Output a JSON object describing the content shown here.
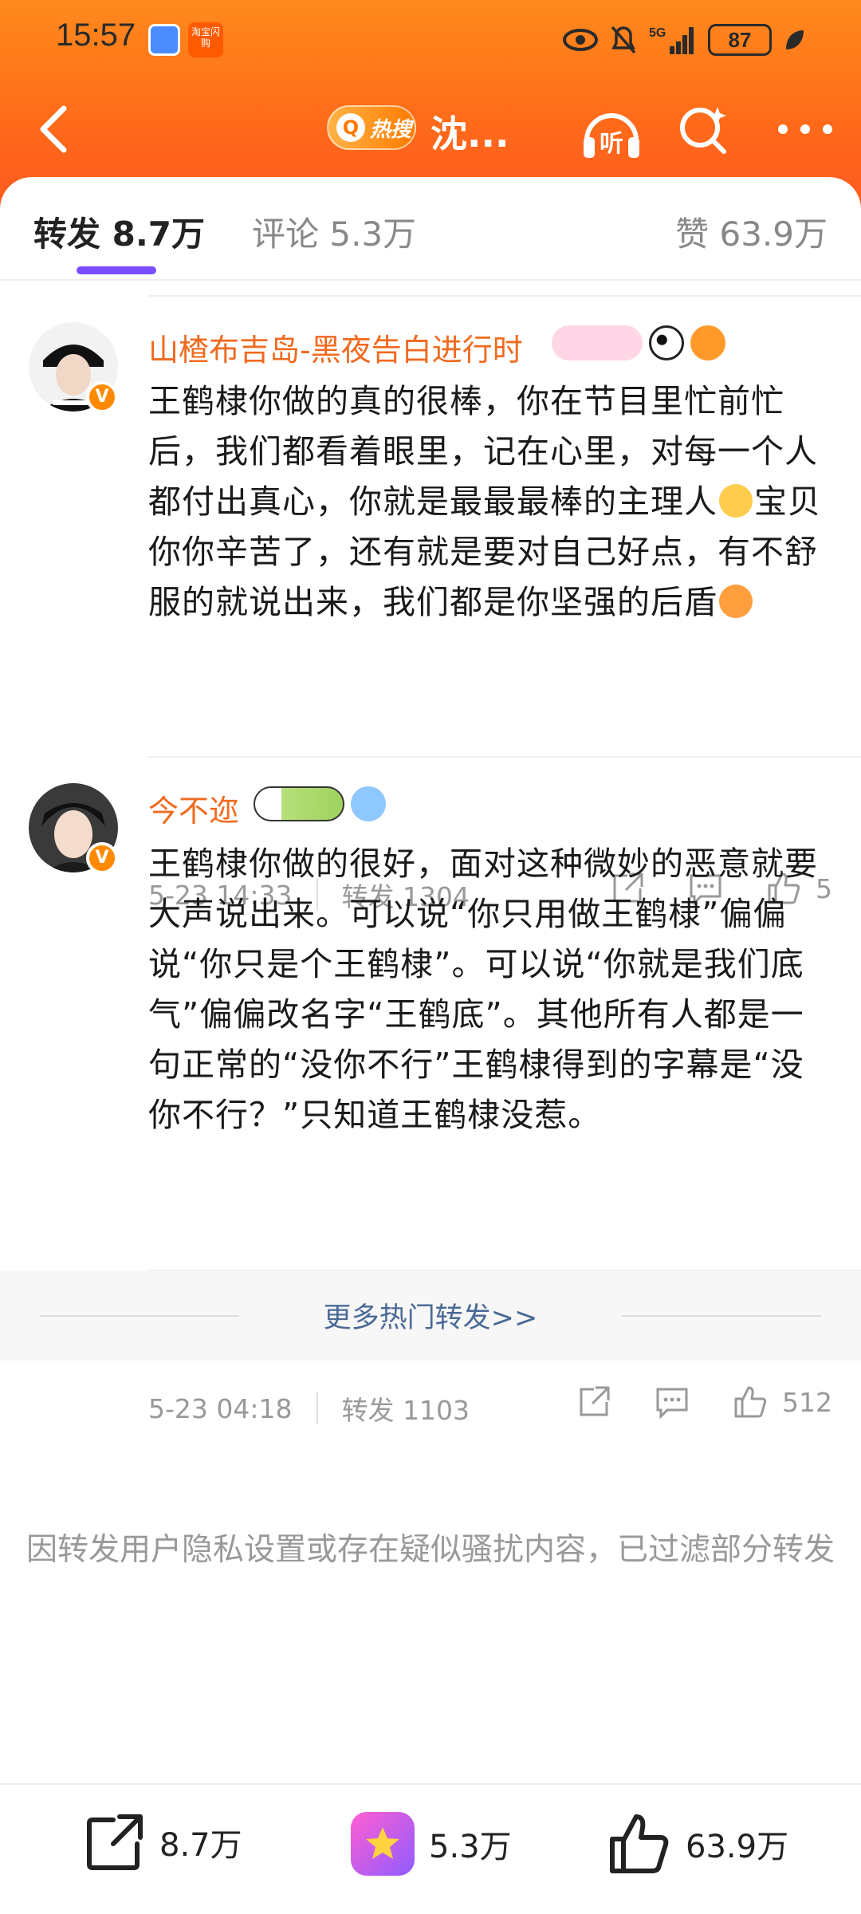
{
  "status_bar": {
    "time": "15:57",
    "battery": "87",
    "network": "5G",
    "app_icon_2_text": "淘宝闪购"
  },
  "nav": {
    "hot_badge": "热搜",
    "title": "沈...",
    "listen_label": "听"
  },
  "tabs": {
    "repost": "转发 8.7万",
    "comment": "评论 5.3万",
    "like": "赞 63.9万"
  },
  "posts": [
    {
      "username": "山楂布吉岛-黑夜告白进行时",
      "content_part1": "王鹤棣你做的真的很棒，你在节目里忙前忙后，我们都看着眼里，记在心里，对每一个人都付出真心，你就是最最最棒的主理人",
      "content_part2": "宝贝你你辛苦了，还有就是要对自己好点，有不舒服的就说出来，我们都是你坚强的后盾",
      "time": "5-23 14:33",
      "repost": "转发 1304",
      "likes": "5"
    },
    {
      "username": "今不迩",
      "content": "王鹤棣你做的很好，面对这种微妙的恶意就要大声说出来。可以说“你只用做王鹤棣”偏偏说“你只是个王鹤棣”。可以说“你就是我们底气”偏偏改名字“王鹤底”。其他所有人都是一句正常的“没你不行”王鹤棣得到的字幕是“没你不行？”只知道王鹤棣没惹。",
      "time": "5-23 04:18",
      "repost": "转发 1103",
      "likes": "512"
    }
  ],
  "more_hot": "更多热门转发>>",
  "filter_note": "因转发用户隐私设置或存在疑似骚扰内容，已过滤部分转发",
  "bottom_bar": {
    "repost_count": "8.7万",
    "comment_count": "5.3万",
    "like_count": "63.9万"
  },
  "colors": {
    "header_orange": "#ff6a1a",
    "username_orange": "#f06a1f",
    "tab_indicator": "#7a4cff",
    "link_blue": "#4b6a96"
  }
}
